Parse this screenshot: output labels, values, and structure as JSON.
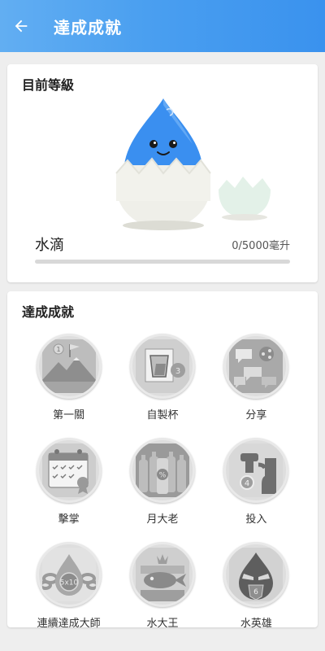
{
  "header": {
    "title": "達成成就",
    "back_icon": "arrow-left-icon"
  },
  "level_card": {
    "title": "目前等級",
    "level_name": "水滴",
    "progress_text": "0/5000毫升",
    "progress_fraction": 0,
    "mascot_color": "#3a8ff0"
  },
  "achievements_card": {
    "title": "達成成就",
    "items": [
      {
        "label": "第一關",
        "icon": "mountain-flag-badge-icon"
      },
      {
        "label": "自製杯",
        "icon": "custom-cup-badge-icon"
      },
      {
        "label": "分享",
        "icon": "share-badge-icon"
      },
      {
        "label": "擊掌",
        "icon": "calendar-badge-icon"
      },
      {
        "label": "月大老",
        "icon": "bottles-badge-icon"
      },
      {
        "label": "投入",
        "icon": "faucet-badge-icon"
      },
      {
        "label": "連續達成大師",
        "icon": "chain-drop-badge-icon"
      },
      {
        "label": "水大王",
        "icon": "fish-king-badge-icon"
      },
      {
        "label": "水英雄",
        "icon": "hero-drop-badge-icon"
      }
    ]
  },
  "colors": {
    "appbar_start": "#62aef2",
    "appbar_end": "#3a92ee",
    "badge_gray": "#9e9e9e"
  }
}
